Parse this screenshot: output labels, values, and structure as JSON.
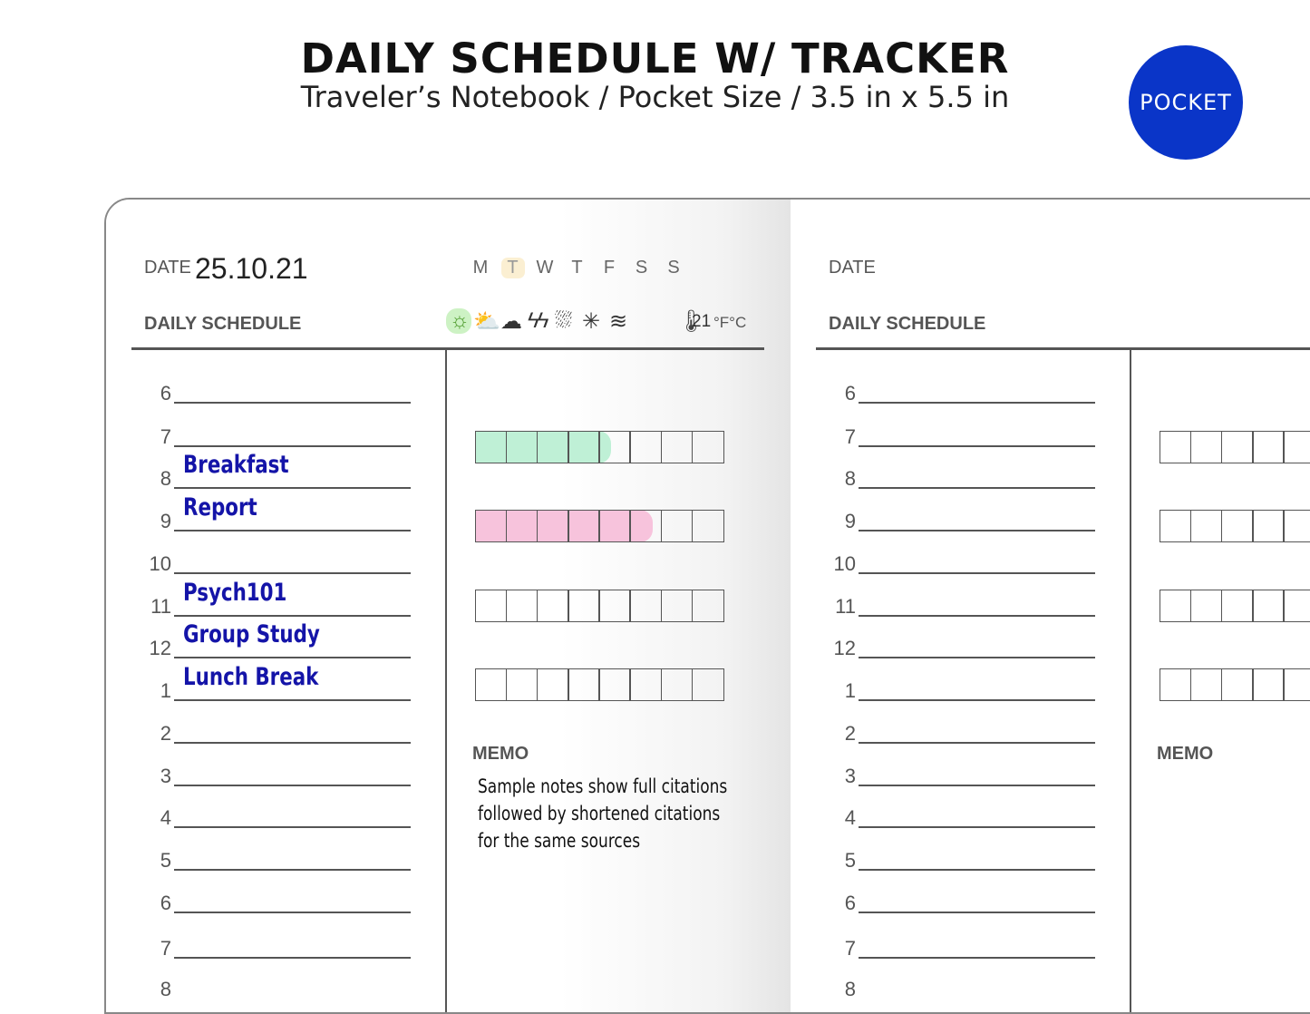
{
  "header": {
    "title": "DAILY SCHEDULE W/ TRACKER",
    "subtitle": "Traveler’s Notebook / Pocket Size / 3.5 in x 5.5 in",
    "badge": "POCKET",
    "badge_color": "#0a35c8"
  },
  "weekdays": [
    "M",
    "T",
    "W",
    "T",
    "F",
    "S",
    "S"
  ],
  "hours": [
    "6",
    "7",
    "8",
    "9",
    "10",
    "11",
    "12",
    "1",
    "2",
    "3",
    "4",
    "5",
    "6",
    "7",
    "8"
  ],
  "left_page": {
    "date_label": "DATE",
    "date_value": "25.10.21",
    "selected_day_index": 1,
    "section_label": "DAILY SCHEDULE",
    "weather_icons": [
      "sun-icon",
      "partly-cloudy-icon",
      "cloud-icon",
      "lightning-icon",
      "rain-icon",
      "snow-icon",
      "wind-icon"
    ],
    "selected_weather": "sun-icon",
    "temperature": "21",
    "temp_units": "°F°C",
    "entries": {
      "8": "Breakfast",
      "9": "Report",
      "11": "Psych101",
      "12": "Group Study",
      "1": "Lunch Break"
    },
    "trackers": [
      {
        "filled": 4,
        "color": "#bff0d6"
      },
      {
        "filled": 5.3,
        "color": "#f7c3dc"
      },
      {
        "filled": 0
      },
      {
        "filled": 0
      }
    ],
    "memo_label": "MEMO",
    "memo_lines": [
      "Sample notes show full citations",
      "followed by shortened citations",
      "for the same sources"
    ]
  },
  "right_page": {
    "date_label": "DATE",
    "section_label": "DAILY SCHEDULE",
    "memo_label": "MEMO"
  }
}
